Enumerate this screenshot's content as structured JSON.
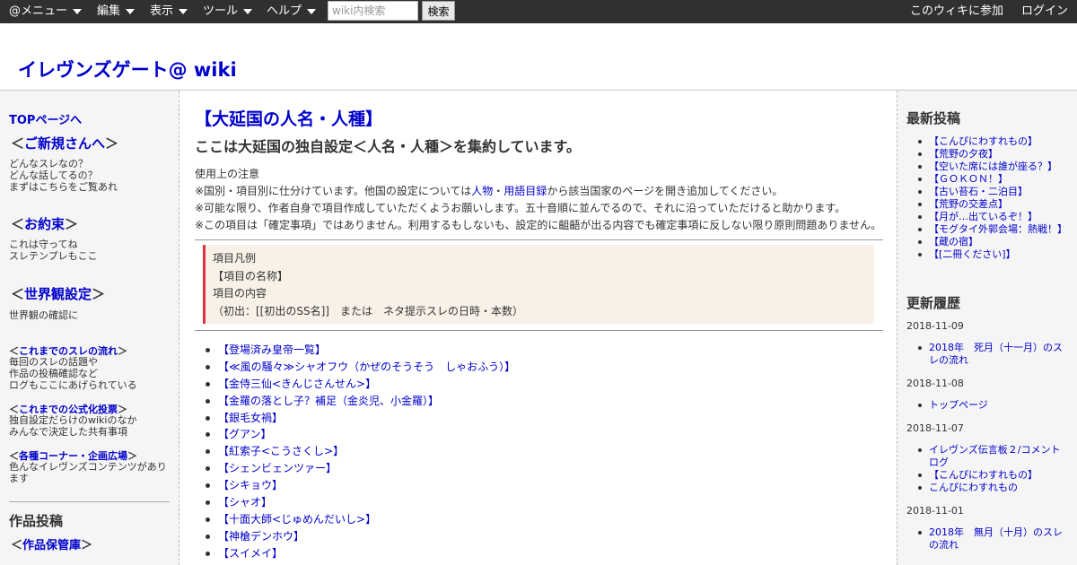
{
  "topbar": {
    "menus": [
      "@メニュー",
      "編集",
      "表示",
      "ツール",
      "ヘルプ"
    ],
    "search_placeholder": "wiki内検索",
    "search_button": "検索",
    "join_label": "このウィキに参加",
    "login_label": "ログイン"
  },
  "site": {
    "title": "イレヴンズゲート@ wiki"
  },
  "left": {
    "top_link": "TOPページへ",
    "newcomer": {
      "prefix": "＜",
      "link": "ご新規さんへ",
      "suffix": "＞",
      "desc": [
        "どんなスレなの？",
        "どんな話してるの？",
        "まずはこちらをご覧あれ"
      ]
    },
    "promise": {
      "prefix": "＜",
      "link": "お約束",
      "suffix": "＞",
      "desc": [
        "これは守ってね",
        "スレテンプレもここ"
      ]
    },
    "worldview": {
      "prefix": "＜",
      "link": "世界観設定",
      "suffix": "＞",
      "desc": [
        "世界観の確認に"
      ]
    },
    "threads": {
      "prefix": "＜",
      "link": "これまでのスレの流れ",
      "suffix": "＞",
      "desc": [
        "毎回のスレの話題や",
        "作品の投稿確認など",
        "ログもここにあげられている"
      ]
    },
    "votes": {
      "prefix": "＜",
      "link": "これまでの公式化投票",
      "suffix": "＞",
      "desc": [
        "独自設定だらけのwikiのなか",
        "みんなで決定した共有事項"
      ]
    },
    "corners": {
      "prefix": "＜",
      "link": "各種コーナー・企画広場",
      "suffix": "＞",
      "desc": [
        "色んなイレヴンズコンテンツがあり",
        "ます"
      ]
    },
    "works_heading": "作品投稿",
    "archive": {
      "prefix": "＜",
      "link": "作品保管庫",
      "suffix": "＞"
    }
  },
  "main": {
    "title": "【大延国の人名・人種】",
    "subtitle": "ここは大延国の独自設定＜人名・人種＞を集約しています。",
    "notes_heading": "使用上の注意",
    "note1": {
      "before": "※国別・項目別に仕分けています。他国の設定については",
      "link1": "人物",
      "mid": "・",
      "link2": "用語目録",
      "after": "から該当国家のページを開き追加してください。"
    },
    "note2": "※可能な限り、作者自身で項目作成していただくようお願いします。五十音順に並んでるので、それに沿っていただけると助かります。",
    "note3": "※この項目は「確定事項」ではありません。利用するもしないも、設定的に齟齬が出る内容でも確定事項に反しない限り原則問題ありません。",
    "legend": [
      "項目凡例",
      "【項目の名称】",
      "項目の内容",
      "（初出：[[初出のSS名]]　または　ネタ提示スレの日時・本数）"
    ],
    "entries": [
      "【登場済み皇帝一覧】",
      "【≪風の騒々≫シャオフウ（かぜのそうそう　しゃおふう）】",
      "【金侍三仙<きんじさんせん>】",
      "【金羅の落とし子？補足（金炎児、小金羅）】",
      "【銀毛女禍】",
      "【グアン】",
      "【紅索子<こうさくし>】",
      "【シェンビェンツァー】",
      "【シキョウ】",
      "【シャオ】",
      "【十面大師<じゅめんだいし>】",
      "【神槍デンホウ】",
      "【スイメイ】"
    ]
  },
  "right": {
    "latest_heading": "最新投稿",
    "latest": [
      "【こんぴにわすれもの】",
      "【荒野の夕夜】",
      "【空いた席には誰が座る？】",
      "【ＧＯＫＯＮ！】",
      "【古い苔石・二泊目】",
      "【荒野の交差点】",
      "【月が…出ているぞ！】",
      "【モグタイ外郭会場：熱戦！】",
      "【蔵の宿】",
      "【[二冊ください]】"
    ],
    "history_heading": "更新履歴",
    "history": [
      {
        "date": "2018-11-09",
        "items": [
          [
            "2018年　死月（十一月）のス",
            "レの流れ"
          ]
        ]
      },
      {
        "date": "2018-11-08",
        "items": [
          [
            "トップページ"
          ]
        ]
      },
      {
        "date": "2018-11-07",
        "items": [
          [
            "イレヴンズ伝言板２/コメント",
            "ログ"
          ],
          [
            "【こんぴにわすれもの】"
          ],
          [
            "こんぴにわすれもの"
          ]
        ]
      },
      {
        "date": "2018-11-01",
        "items": [
          [
            "2018年　無月（十月）のスレ",
            "の流れ"
          ]
        ]
      }
    ]
  }
}
